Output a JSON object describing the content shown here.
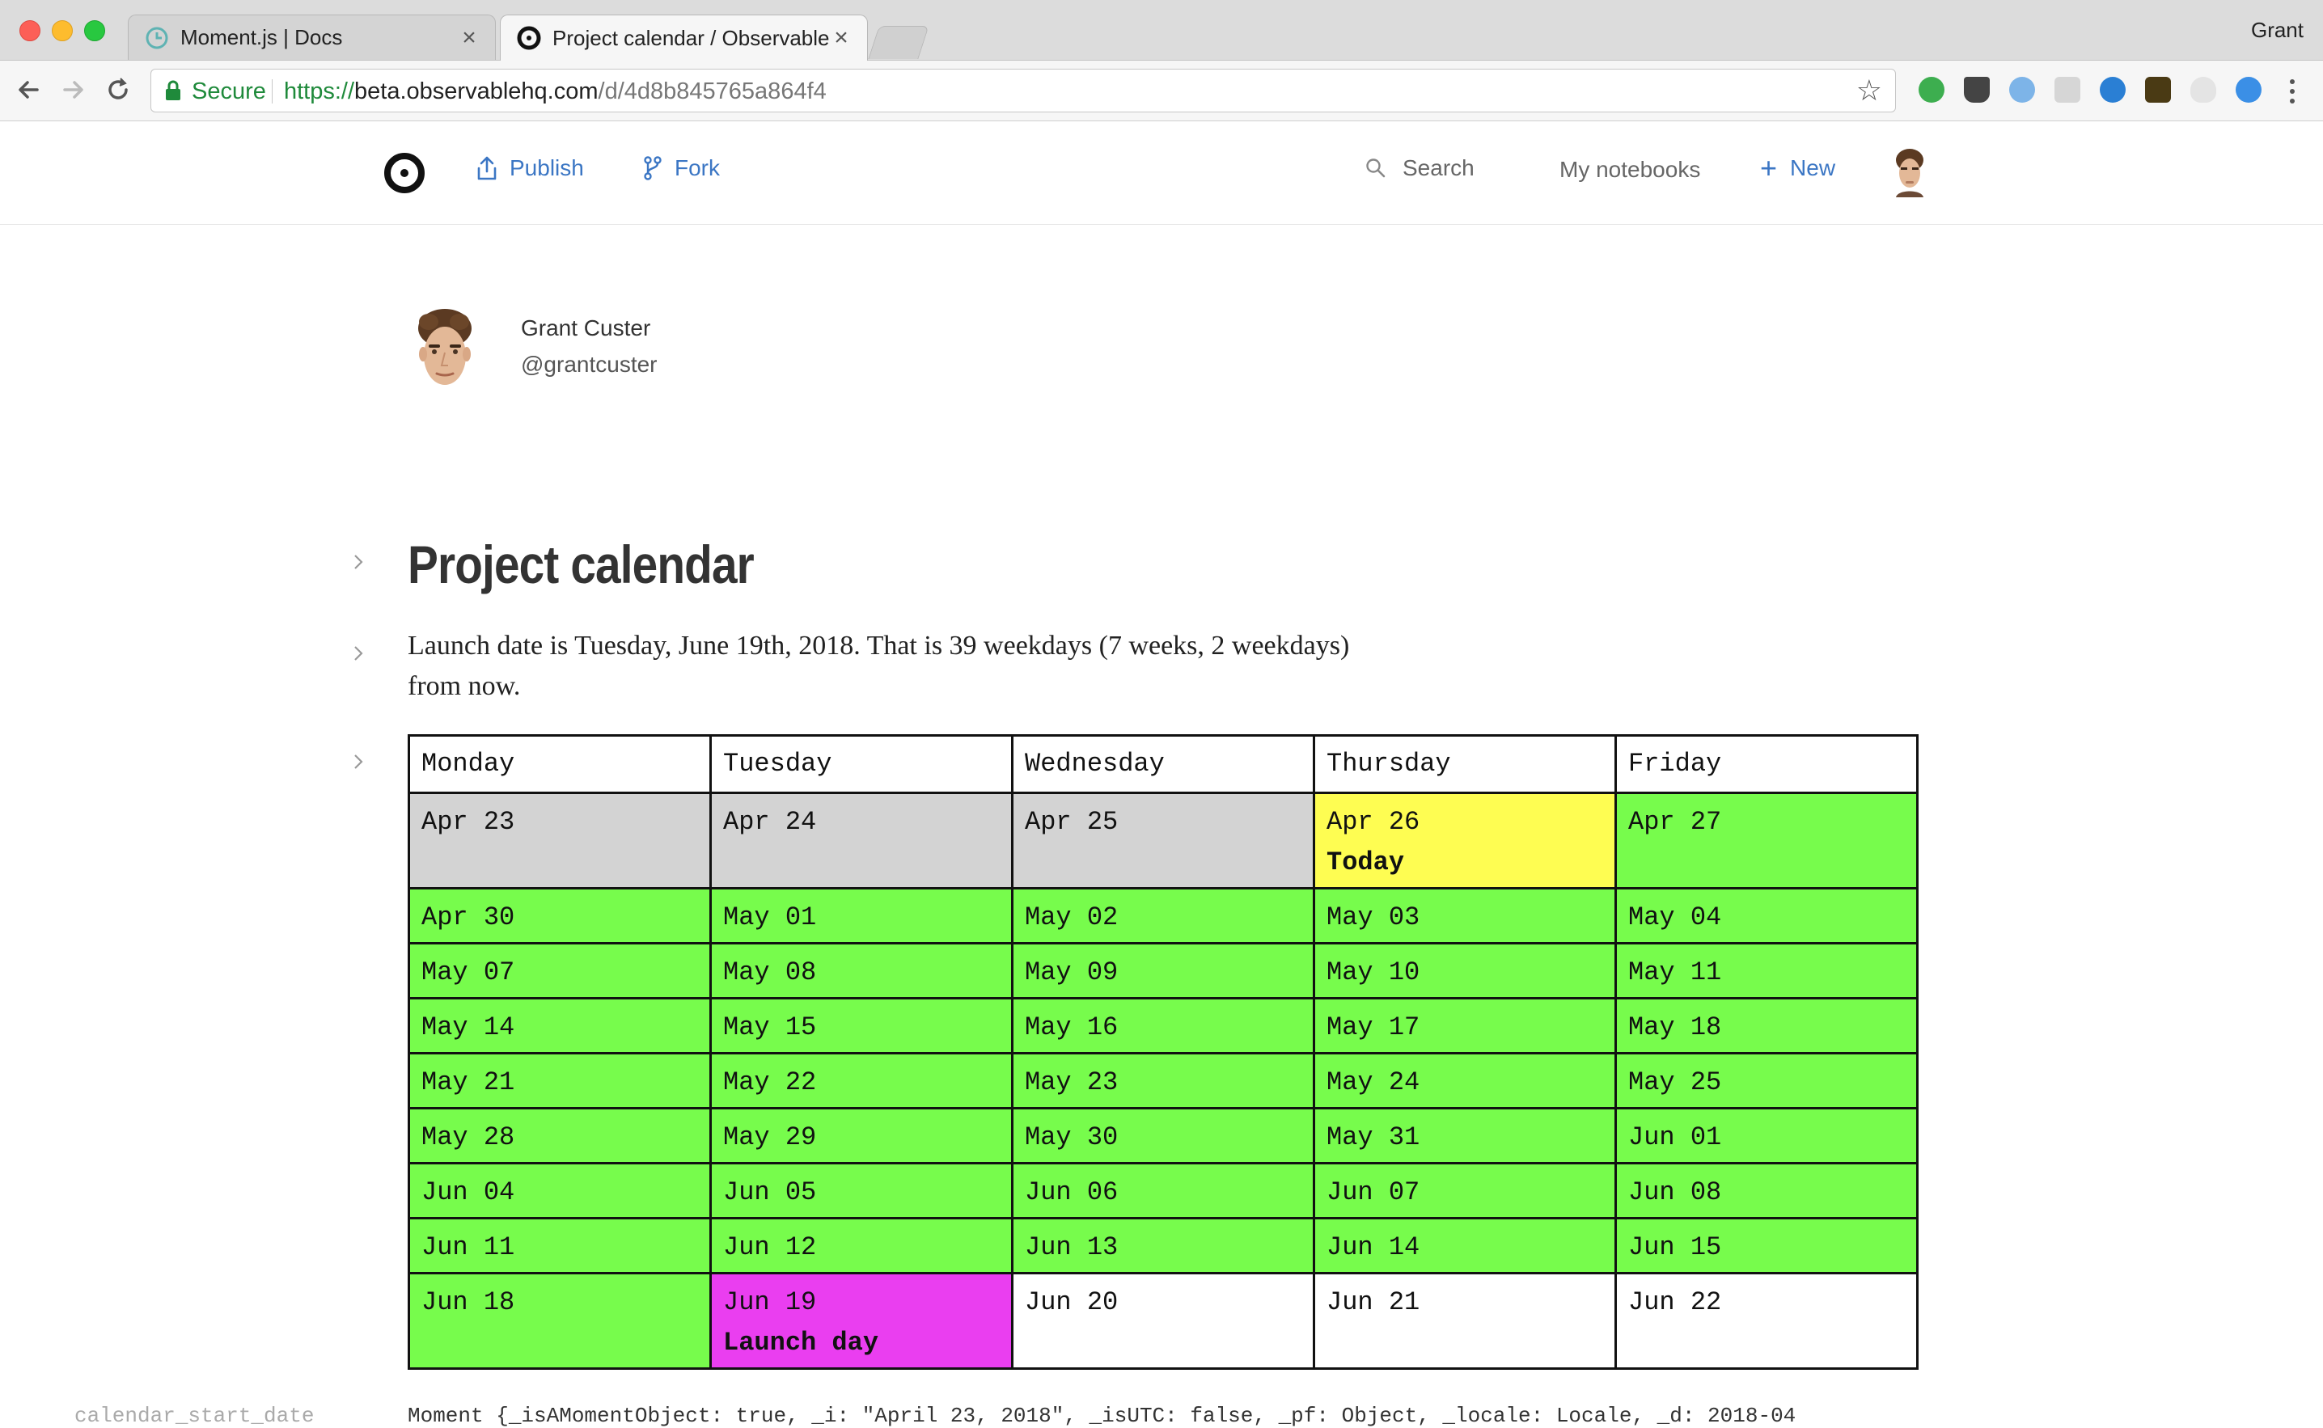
{
  "browser": {
    "tabs": [
      {
        "title": "Moment.js | Docs",
        "favicon": "clock-icon",
        "active": false
      },
      {
        "title": "Project calendar / Observable",
        "favicon": "observable-icon",
        "active": true
      }
    ],
    "profile_name": "Grant",
    "secure_label": "Secure",
    "url": {
      "scheme": "https://",
      "host": "beta.observablehq.com",
      "path": "/d/4d8b845765a864f4"
    }
  },
  "header": {
    "publish_label": "Publish",
    "fork_label": "Fork",
    "search_label": "Search",
    "my_notebooks_label": "My notebooks",
    "new_label": "New",
    "accent_color": "#3b76c4"
  },
  "author": {
    "name": "Grant Custer",
    "handle": "@grantcuster"
  },
  "notebook": {
    "title": "Project calendar",
    "description": "Launch date is Tuesday, June 19th, 2018. That is 39 weekdays (7 weeks, 2 weekdays) from now."
  },
  "calendar": {
    "headers": [
      "Monday",
      "Tuesday",
      "Wednesday",
      "Thursday",
      "Friday"
    ],
    "colors": {
      "past": "#d3d3d3",
      "work": "#77fc4c",
      "today": "#fefd52",
      "launch": "#ea3ef0",
      "after": "#ffffff"
    },
    "weeks": [
      [
        {
          "date": "Apr 23",
          "status": "past"
        },
        {
          "date": "Apr 24",
          "status": "past"
        },
        {
          "date": "Apr 25",
          "status": "past"
        },
        {
          "date": "Apr 26",
          "status": "today",
          "label": "Today"
        },
        {
          "date": "Apr 27",
          "status": "work"
        }
      ],
      [
        {
          "date": "Apr 30",
          "status": "work"
        },
        {
          "date": "May 01",
          "status": "work"
        },
        {
          "date": "May 02",
          "status": "work"
        },
        {
          "date": "May 03",
          "status": "work"
        },
        {
          "date": "May 04",
          "status": "work"
        }
      ],
      [
        {
          "date": "May 07",
          "status": "work"
        },
        {
          "date": "May 08",
          "status": "work"
        },
        {
          "date": "May 09",
          "status": "work"
        },
        {
          "date": "May 10",
          "status": "work"
        },
        {
          "date": "May 11",
          "status": "work"
        }
      ],
      [
        {
          "date": "May 14",
          "status": "work"
        },
        {
          "date": "May 15",
          "status": "work"
        },
        {
          "date": "May 16",
          "status": "work"
        },
        {
          "date": "May 17",
          "status": "work"
        },
        {
          "date": "May 18",
          "status": "work"
        }
      ],
      [
        {
          "date": "May 21",
          "status": "work"
        },
        {
          "date": "May 22",
          "status": "work"
        },
        {
          "date": "May 23",
          "status": "work"
        },
        {
          "date": "May 24",
          "status": "work"
        },
        {
          "date": "May 25",
          "status": "work"
        }
      ],
      [
        {
          "date": "May 28",
          "status": "work"
        },
        {
          "date": "May 29",
          "status": "work"
        },
        {
          "date": "May 30",
          "status": "work"
        },
        {
          "date": "May 31",
          "status": "work"
        },
        {
          "date": "Jun 01",
          "status": "work"
        }
      ],
      [
        {
          "date": "Jun 04",
          "status": "work"
        },
        {
          "date": "Jun 05",
          "status": "work"
        },
        {
          "date": "Jun 06",
          "status": "work"
        },
        {
          "date": "Jun 07",
          "status": "work"
        },
        {
          "date": "Jun 08",
          "status": "work"
        }
      ],
      [
        {
          "date": "Jun 11",
          "status": "work"
        },
        {
          "date": "Jun 12",
          "status": "work"
        },
        {
          "date": "Jun 13",
          "status": "work"
        },
        {
          "date": "Jun 14",
          "status": "work"
        },
        {
          "date": "Jun 15",
          "status": "work"
        }
      ],
      [
        {
          "date": "Jun 18",
          "status": "work"
        },
        {
          "date": "Jun 19",
          "status": "launch",
          "label": "Launch day"
        },
        {
          "date": "Jun 20",
          "status": "after"
        },
        {
          "date": "Jun 21",
          "status": "after"
        },
        {
          "date": "Jun 22",
          "status": "after"
        }
      ]
    ]
  },
  "inspector": {
    "cell_name": "calendar_start_date",
    "value_text": "Moment {_isAMomentObject: true, _i: \"April 23, 2018\", _isUTC: false, _pf: Object, _locale: Locale, _d: 2018-04"
  }
}
